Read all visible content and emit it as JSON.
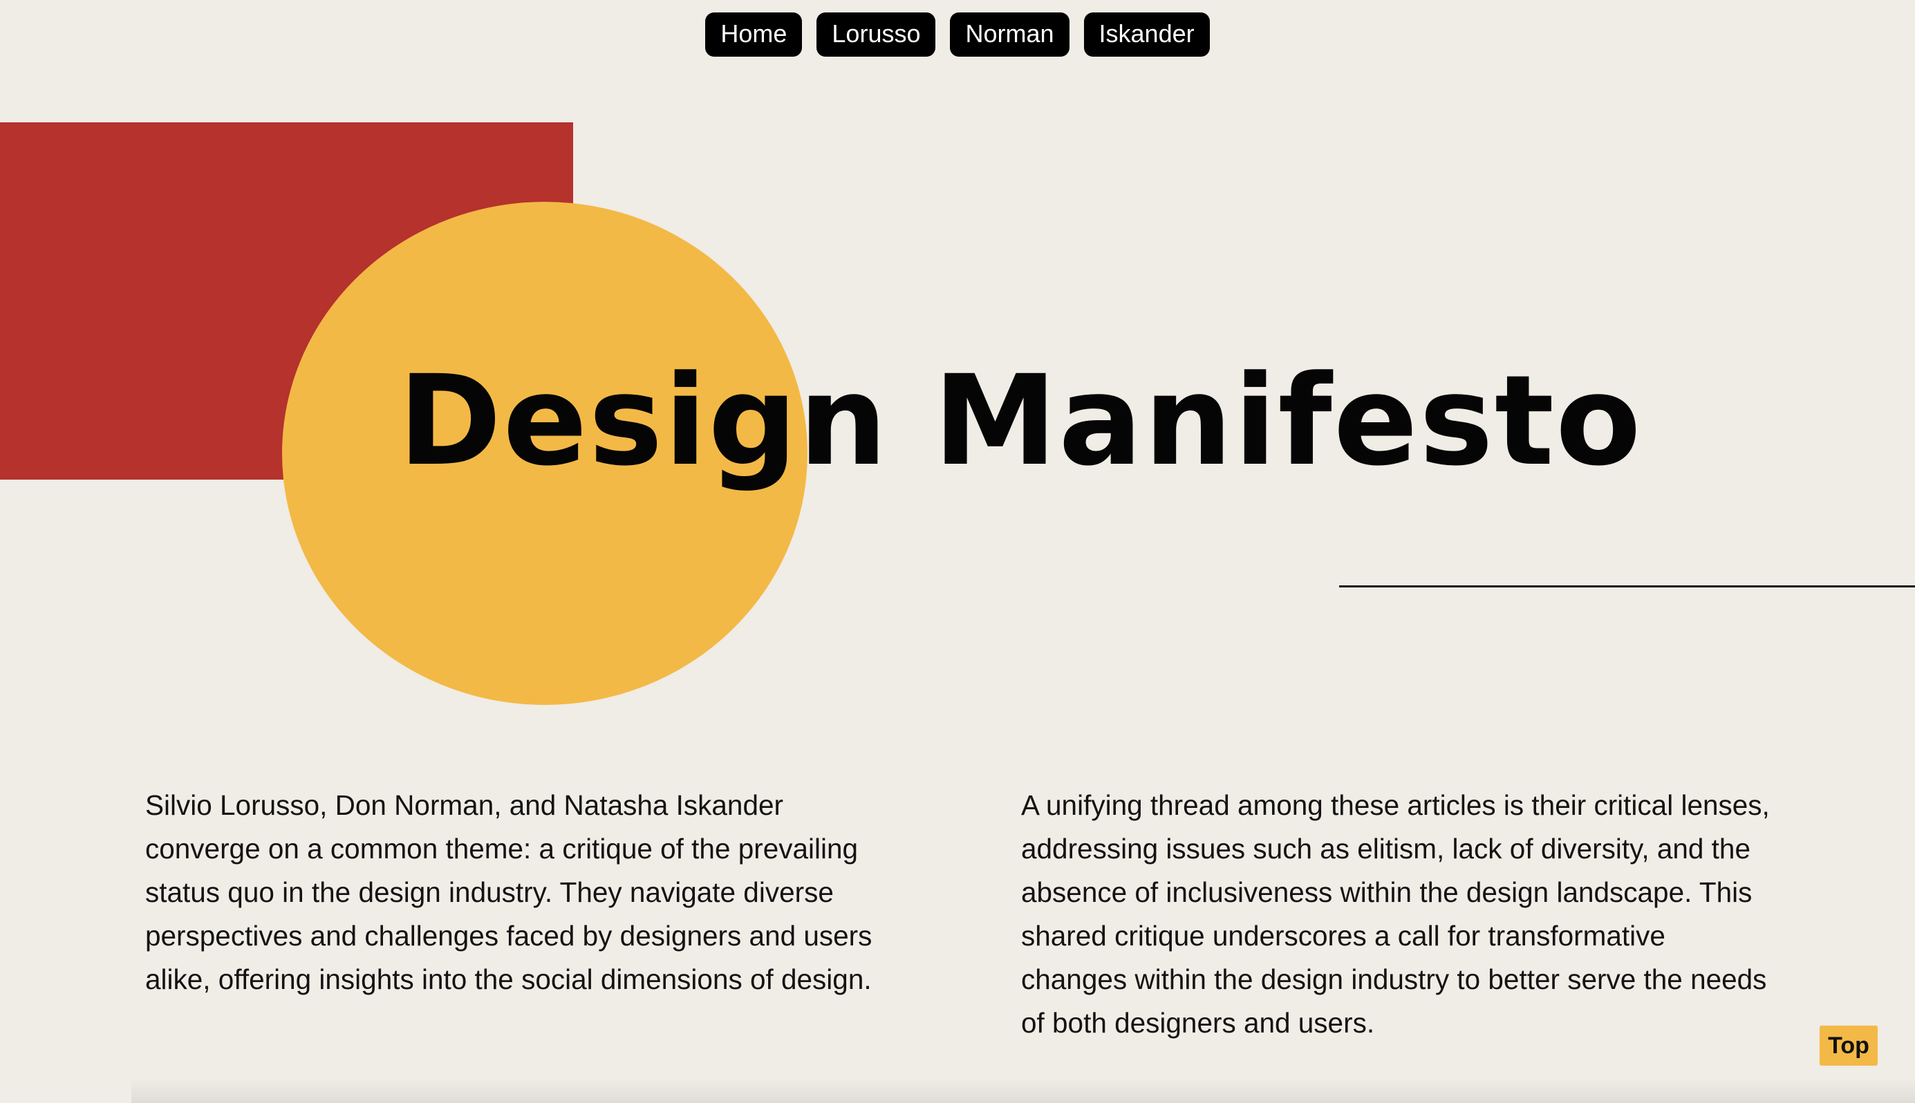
{
  "nav": {
    "items": [
      {
        "label": "Home"
      },
      {
        "label": "Lorusso"
      },
      {
        "label": "Norman"
      },
      {
        "label": "Iskander"
      }
    ]
  },
  "hero": {
    "title": "Design Manifesto"
  },
  "content": {
    "left_paragraph": "Silvio Lorusso, Don Norman, and Natasha Iskander converge on a common theme: a critique of the prevailing status quo in the design industry. They navigate diverse perspectives and challenges faced by designers and users alike, offering insights into the social dimensions of design.",
    "right_paragraph": "A unifying thread among these articles is their critical lenses, addressing issues such as elitism, lack of diversity, and the absence of inclusiveness within the design landscape. This shared critique underscores a call for transformative changes within the design industry to better serve the needs of both designers and users."
  },
  "back_to_top": {
    "label": "Top"
  },
  "colors": {
    "background": "#f0ece6",
    "red_accent": "#b5322d",
    "yellow_accent": "#f3b946",
    "nav_button": "#000000",
    "text": "#111111"
  }
}
